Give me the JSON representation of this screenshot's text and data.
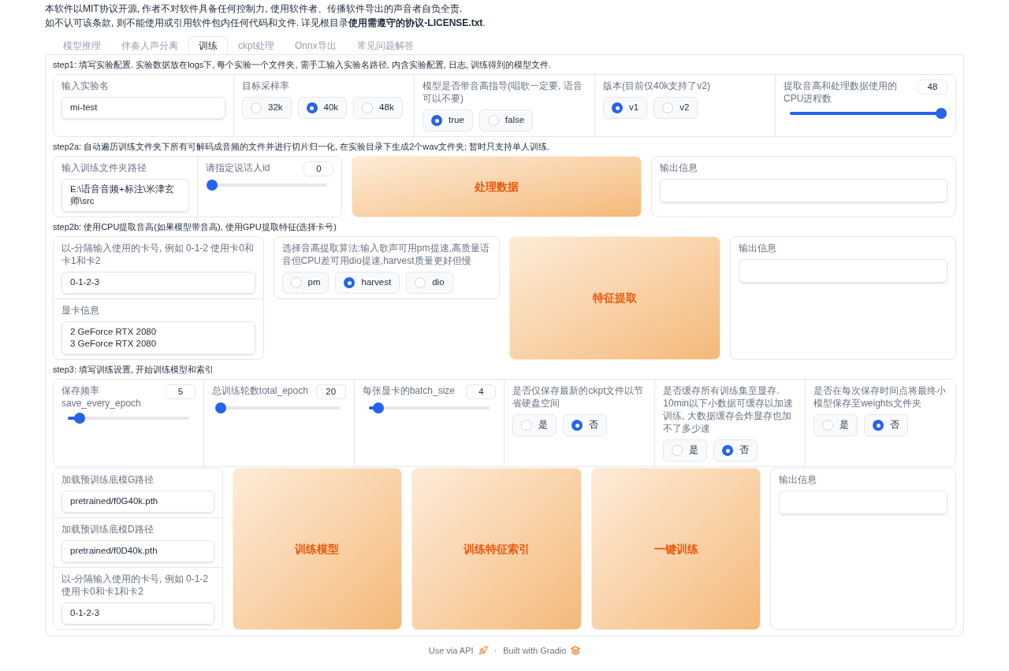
{
  "notice": [
    "本软件以MIT协议开源, 作者不对软件具备任何控制力, 使用软件者、传播软件导出的声音者自负全责.",
    "如不认可该条款, 则不能使用或引用软件包内任何代码和文件. 详见根目录**使用需遵守的协议-LICENSE.txt**."
  ],
  "tabs": [
    {
      "label": "模型推理",
      "selected": false
    },
    {
      "label": "伴奏人声分离",
      "selected": false
    },
    {
      "label": "训练",
      "selected": true
    },
    {
      "label": "ckpt处理",
      "selected": false
    },
    {
      "label": "Onnx导出",
      "selected": false
    },
    {
      "label": "常见问题解答",
      "selected": false
    }
  ],
  "sections": [
    {
      "title": "step1: 填写实验配置. 实验数据放在logs下, 每个实验一个文件夹, 需手工输入实验名路径, 内含实验配置, 日志, 训练得到的模型文件.",
      "rows": [
        [
          {
            "kind": "row",
            "items": [
              {
                "kind": "textbox",
                "label": "输入实验名",
                "value": "mi-test"
              },
              {
                "kind": "radio",
                "label": "目标采样率",
                "options": [
                  {
                    "label": "32k",
                    "selected": false
                  },
                  {
                    "label": "40k",
                    "selected": true
                  },
                  {
                    "label": "48k",
                    "selected": false
                  }
                ]
              },
              {
                "kind": "radio",
                "label": "模型是否带音高指导(唱歌一定要, 语音可以不要)",
                "options": [
                  {
                    "label": "true",
                    "selected": true
                  },
                  {
                    "label": "false",
                    "selected": false
                  }
                ]
              },
              {
                "kind": "radio",
                "label": "版本(目前仅40k支持了v2)",
                "options": [
                  {
                    "label": "v1",
                    "selected": true
                  },
                  {
                    "label": "v2",
                    "selected": false
                  }
                ]
              },
              {
                "kind": "slider",
                "label": "提取音高和处理数据使用的CPU进程数",
                "value": "48",
                "level": 1
              }
            ]
          }
        ]
      ]
    },
    {
      "title": "step2a: 自动遍历训练文件夹下所有可解码成音频的文件并进行切片归一化, 在实验目录下生成2个wav文件夹; 暂时只支持单人训练.",
      "rows": [
        [
          {
            "kind": "row",
            "items": [
              {
                "kind": "textbox",
                "label": "输入训练文件夹路径",
                "value": "E:\\语音音频+标注\\米津玄师\\src"
              },
              {
                "kind": "slider",
                "label": "请指定说话人id",
                "value": "0",
                "level": 0
              }
            ]
          },
          {
            "kind": "button",
            "label": "处理数据"
          },
          {
            "kind": "output",
            "label": "输出信息"
          }
        ]
      ]
    },
    {
      "title": "step2b: 使用CPU提取音高(如果模型带音高), 使用GPU提取特征(选择卡号)",
      "rows": [
        [
          {
            "kind": "column",
            "items": [
              {
                "kind": "textbox",
                "label": "以-分隔输入使用的卡号, 例如 0-1-2 使用卡0和卡1和卡2",
                "value": "0-1-2-3"
              },
              {
                "kind": "textbox",
                "label": "显卡信息",
                "value": "2 GeForce RTX 2080\n3 GeForce RTX 2080"
              }
            ]
          },
          {
            "kind": "radio",
            "label": "选择音高提取算法:输入歌声可用pm提速,高质量语音但CPU差可用dio提速,harvest质量更好但慢",
            "options": [
              {
                "label": "pm",
                "selected": false
              },
              {
                "label": "harvest",
                "selected": true
              },
              {
                "label": "dio",
                "selected": false
              }
            ]
          },
          {
            "kind": "button",
            "label": "特征提取"
          },
          {
            "kind": "output",
            "label": "输出信息"
          }
        ]
      ]
    },
    {
      "title": "step3: 填写训练设置, 开始训练模型和索引",
      "rows": [
        [
          {
            "kind": "row",
            "items": [
              {
                "kind": "slider",
                "label": "保存频率save_every_epoch",
                "value": "5",
                "level": 0.1
              },
              {
                "kind": "slider",
                "label": "总训练轮数total_epoch",
                "value": "20",
                "level": 0.02
              },
              {
                "kind": "slider",
                "label": "每张显卡的batch_size",
                "value": "4",
                "level": 0.08
              },
              {
                "kind": "radio",
                "label": "是否仅保存最新的ckpt文件以节省硬盘空间",
                "options": [
                  {
                    "label": "是",
                    "selected": false
                  },
                  {
                    "label": "否",
                    "selected": true
                  }
                ]
              },
              {
                "kind": "radio",
                "label": "是否缓存所有训练集至显存. 10min以下小数据可缓存以加速训练, 大数据缓存会炸显存也加不了多少速",
                "options": [
                  {
                    "label": "是",
                    "selected": false
                  },
                  {
                    "label": "否",
                    "selected": true
                  }
                ]
              },
              {
                "kind": "radio",
                "label": "是否在每次保存时间点将最终小模型保存至weights文件夹",
                "options": [
                  {
                    "label": "是",
                    "selected": false
                  },
                  {
                    "label": "否",
                    "selected": true
                  }
                ]
              }
            ]
          }
        ],
        [
          {
            "kind": "column",
            "items": [
              {
                "kind": "textbox",
                "label": "加载预训练底模G路径",
                "value": "pretrained/f0G40k.pth"
              },
              {
                "kind": "textbox",
                "label": "加载预训练底模D路径",
                "value": "pretrained/f0D40k.pth"
              },
              {
                "kind": "textbox",
                "label": "以-分隔输入使用的卡号, 例如 0-1-2 使用卡0和卡1和卡2",
                "value": "0-1-2-3"
              }
            ]
          },
          {
            "kind": "button",
            "label": "训练模型"
          },
          {
            "kind": "button",
            "label": "训练特征索引"
          },
          {
            "kind": "button",
            "label": "一键训练"
          },
          {
            "kind": "output",
            "label": "输出信息"
          }
        ]
      ]
    }
  ],
  "footer": {
    "api_link": "Use via API",
    "separator": "·",
    "built_with": "Built with Gradio"
  }
}
